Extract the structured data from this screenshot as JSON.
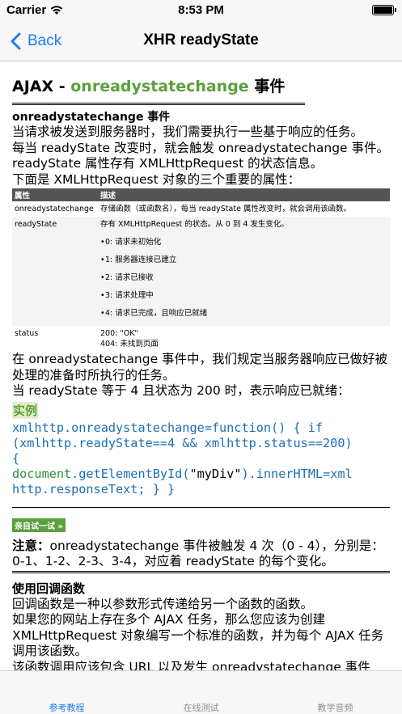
{
  "status_bar": {
    "carrier": "Carrier",
    "time": "8:53 PM",
    "wifi_icon": "wifi-icon",
    "battery_icon": "battery-icon"
  },
  "nav": {
    "back_label": "Back",
    "title": "XHR readyState",
    "back_icon": "chevron-left-icon"
  },
  "article": {
    "heading_prefix": "AJAX - ",
    "heading_highlight": "onreadystatechange",
    "heading_suffix": " 事件",
    "section_title": "onreadystatechange 事件",
    "intro": [
      "当请求被发送到服务器时，我们需要执行一些基于响应的任务。",
      "每当 readyState 改变时，就会触发 onreadystatechange 事件。",
      "readyState 属性存有 XMLHttpRequest 的状态信息。",
      "下面是 XMLHttpRequest 对象的三个重要的属性："
    ],
    "table": {
      "headers": [
        "属性",
        "描述"
      ],
      "rows": [
        {
          "name": "onreadystatechange",
          "desc": "存储函数（或函数名），每当 readyState 属性改变时，就会调用该函数。"
        },
        {
          "name": "readyState",
          "desc": "存有 XMLHttpRequest 的状态。从 0 到 4 发生变化。",
          "items": [
            "0: 请求未初始化",
            "1: 服务器连接已建立",
            "2: 请求已接收",
            "3: 请求处理中",
            "4: 请求已完成，且响应已就绪"
          ]
        },
        {
          "name": "status",
          "desc_lines": [
            "200: \"OK\"",
            "404: 未找到页面"
          ]
        }
      ]
    },
    "after_table": [
      "在 onreadystatechange 事件中，我们规定当服务器响应已做好被处理的准备时所执行的任务。",
      "当 readyState 等于 4 且状态为 200 时，表示响应已就绪："
    ],
    "example_heading": "实例",
    "code_lines": [
      "xmlhttp.onreadystatechange=function() { if",
      "(xmlhttp.readyState==4 && xmlhttp.status==200)",
      "{",
      "document.getElementById(\"myDiv\").innerHTML=xml",
      "http.responseText; } }"
    ],
    "try_button": "亲自试一试 »",
    "note_label": "注意：",
    "note_text": "onreadystatechange 事件被触发 4 次（0 - 4），分别是： 0-1、1-2、2-3、3-4，对应着 readyState 的每个变化。",
    "callback_title": "使用回调函数",
    "callback_paragraphs": [
      "回调函数是一种以参数形式传递给另一个函数的函数。",
      "如果您的网站上存在多个 AJAX 任务，那么您应该为创建 XMLHttpRequest 对象编写一个标准的函数，并为每个 AJAX 任务调用该函数。",
      "该函数调用应该包含 URL 以及发生 onreadystatechange 事件"
    ]
  },
  "tabs": [
    {
      "label": "参考教程",
      "active": true
    },
    {
      "label": "在线测试",
      "active": false
    },
    {
      "label": "教学音频",
      "active": false
    }
  ],
  "colors": {
    "accent": "#1a7cf5",
    "green": "#5ba03c",
    "table_header": "#555555"
  }
}
